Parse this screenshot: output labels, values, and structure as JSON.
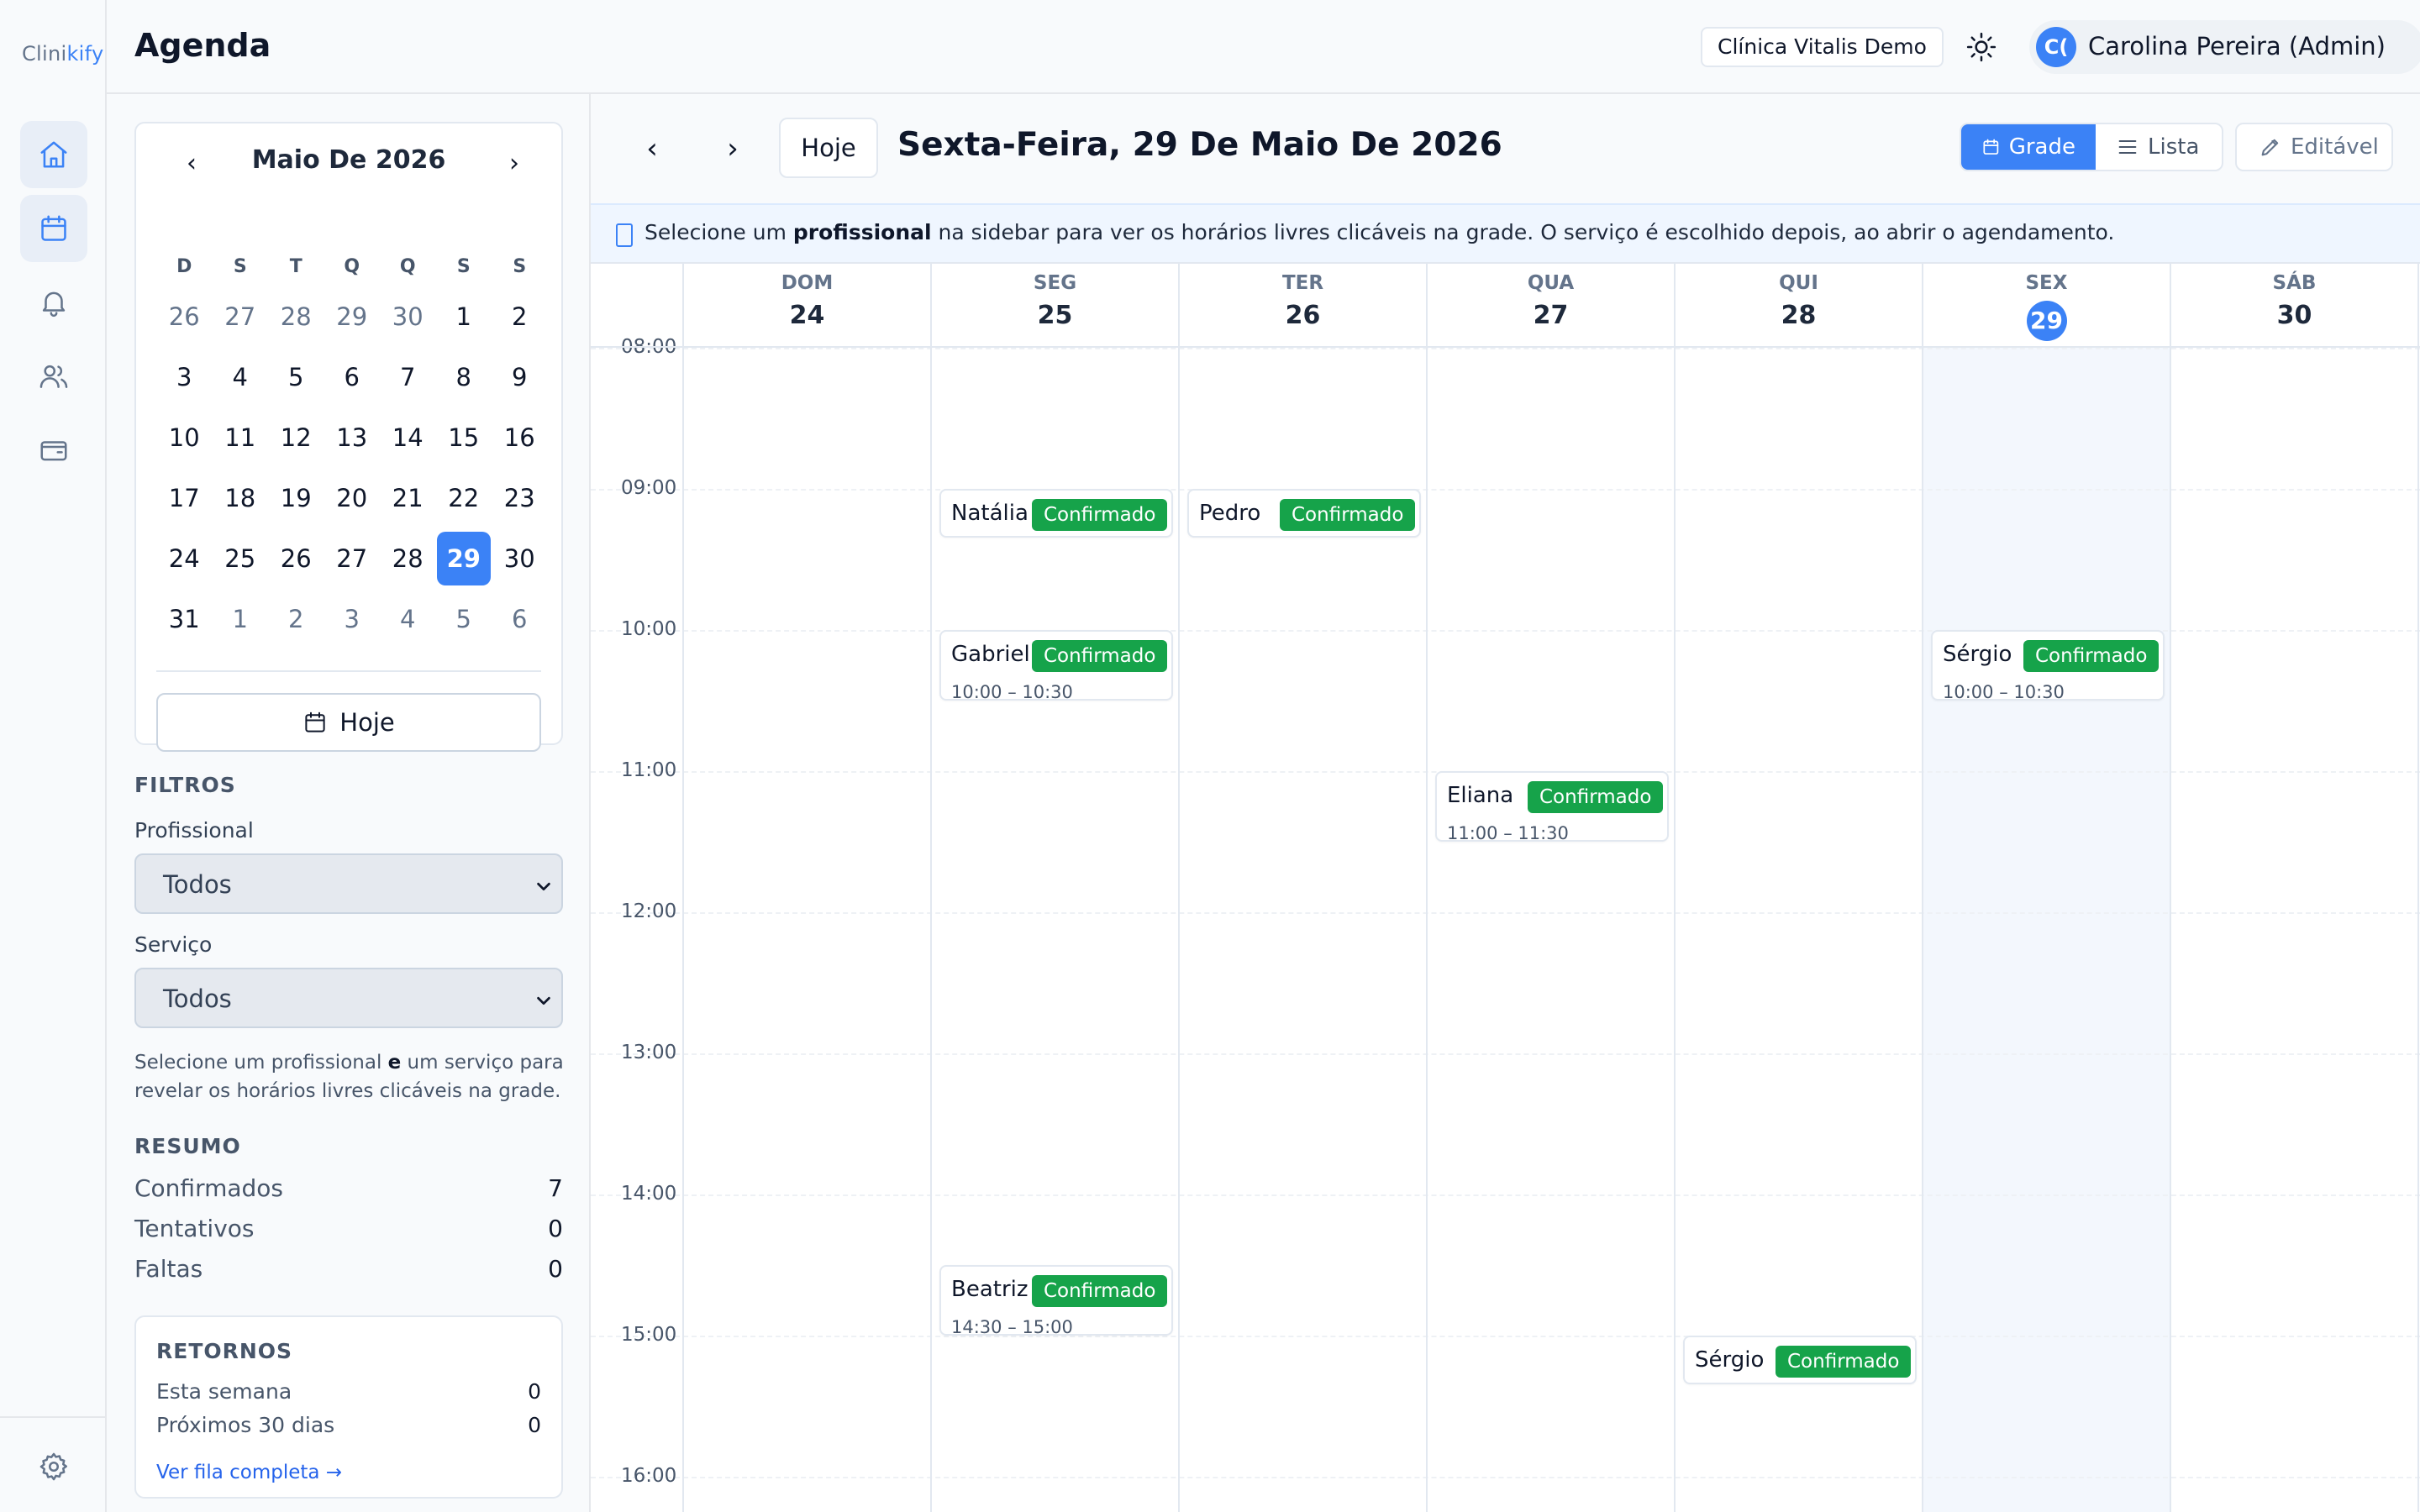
{
  "app": {
    "logo_prefix": "Clini",
    "logo_suffix": "kify"
  },
  "header": {
    "title": "Agenda",
    "clinic": "Clínica Vitalis Demo",
    "user_initials": "C(",
    "user_name": "Carolina Pereira (Admin)"
  },
  "nav": [
    "home-icon",
    "calendar-icon",
    "bell-icon",
    "users-icon",
    "wallet-icon",
    "gear-icon"
  ],
  "mini_calendar": {
    "prev": "‹",
    "next": "›",
    "month": "Maio De 2026",
    "weekdays": [
      "D",
      "S",
      "T",
      "Q",
      "Q",
      "S",
      "S"
    ],
    "weeks": [
      [
        "26",
        "27",
        "28",
        "29",
        "30",
        "1",
        "2"
      ],
      [
        "3",
        "4",
        "5",
        "6",
        "7",
        "8",
        "9"
      ],
      [
        "10",
        "11",
        "12",
        "13",
        "14",
        "15",
        "16"
      ],
      [
        "17",
        "18",
        "19",
        "20",
        "21",
        "22",
        "23"
      ],
      [
        "24",
        "25",
        "26",
        "27",
        "28",
        "29",
        "30"
      ],
      [
        "31",
        "1",
        "2",
        "3",
        "4",
        "5",
        "6"
      ]
    ],
    "selected": "29",
    "today_button": "Hoje"
  },
  "filters": {
    "title": "FILTROS",
    "professional_label": "Profissional",
    "professional_value": "Todos",
    "service_label": "Serviço",
    "service_value": "Todos",
    "hint_before": "Selecione um profissional ",
    "hint_bold": "e",
    "hint_after": " um serviço para revelar os horários livres clicáveis na grade."
  },
  "summary": {
    "title": "RESUMO",
    "rows": [
      {
        "label": "Confirmados",
        "value": "7"
      },
      {
        "label": "Tentativos",
        "value": "0"
      },
      {
        "label": "Faltas",
        "value": "0"
      }
    ]
  },
  "returns": {
    "title": "RETORNOS",
    "rows": [
      {
        "label": "Esta semana",
        "value": "0"
      },
      {
        "label": "Próximos 30 dias",
        "value": "0"
      }
    ],
    "link": "Ver fila completa →"
  },
  "toolbar": {
    "prev": "‹",
    "next": "›",
    "today": "Hoje",
    "date_title": "Sexta-Feira, 29 De Maio De 2026",
    "view_grade": "Grade",
    "view_lista": "Lista",
    "editable": "Editável"
  },
  "info": {
    "before": "Selecione um ",
    "bold": "profissional",
    "after": " na sidebar para ver os horários livres clicáveis na grade. O serviço é escolhido depois, ao abrir o agendamento."
  },
  "week": {
    "days": [
      {
        "dow": "DOM",
        "num": "24"
      },
      {
        "dow": "SEG",
        "num": "25"
      },
      {
        "dow": "TER",
        "num": "26"
      },
      {
        "dow": "QUA",
        "num": "27"
      },
      {
        "dow": "QUI",
        "num": "28"
      },
      {
        "dow": "SEX",
        "num": "29",
        "today": true
      },
      {
        "dow": "SÁB",
        "num": "30"
      }
    ],
    "hours": [
      "08:00",
      "09:00",
      "10:00",
      "11:00",
      "12:00",
      "13:00",
      "14:00",
      "15:00",
      "16:00"
    ],
    "events": [
      {
        "day": 1,
        "start": "09:00",
        "name": "Natália",
        "status": "Confirmado",
        "time": ""
      },
      {
        "day": 2,
        "start": "09:00",
        "name": "Pedro",
        "status": "Confirmado",
        "time": ""
      },
      {
        "day": 1,
        "start": "10:00",
        "name": "Gabriel",
        "status": "Confirmado",
        "time": "10:00 – 10:30"
      },
      {
        "day": 5,
        "start": "10:00",
        "name": "Sérgio",
        "status": "Confirmado",
        "time": "10:00 – 10:30"
      },
      {
        "day": 3,
        "start": "11:00",
        "name": "Eliana",
        "status": "Confirmado",
        "time": "11:00 – 11:30"
      },
      {
        "day": 1,
        "start": "14:30",
        "name": "Beatriz",
        "status": "Confirmado",
        "time": "14:30 – 15:00"
      },
      {
        "day": 4,
        "start": "15:00",
        "name": "Sérgio",
        "status": "Confirmado",
        "time": ""
      }
    ]
  },
  "colors": {
    "accent": "#3b82f6",
    "confirmed": "#16a34a"
  }
}
